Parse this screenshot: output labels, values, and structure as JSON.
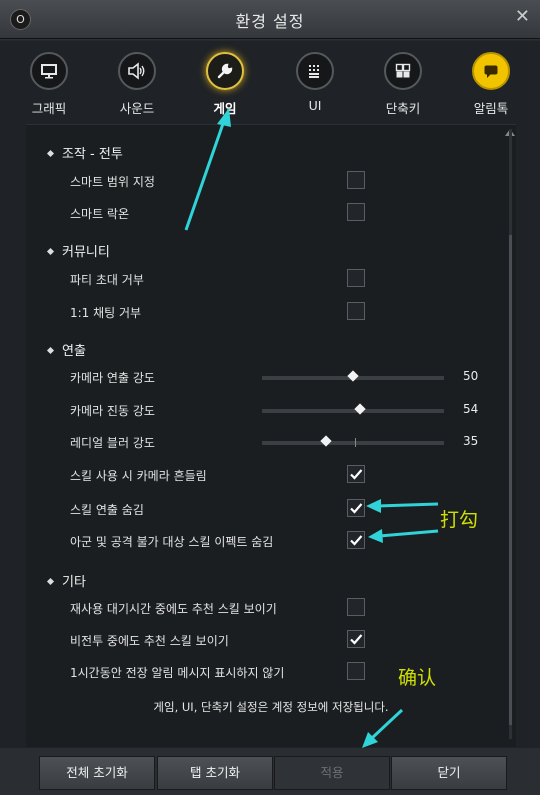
{
  "window": {
    "logo": "O",
    "title": "환경 설정",
    "close_icon": "close-icon"
  },
  "tabs": [
    {
      "label": "그래픽",
      "icon": "monitor-icon",
      "active": false
    },
    {
      "label": "사운드",
      "icon": "speaker-icon",
      "active": false
    },
    {
      "label": "게임",
      "icon": "wrench-icon",
      "active": true
    },
    {
      "label": "UI",
      "icon": "ui-grid-icon",
      "active": false
    },
    {
      "label": "단축키",
      "icon": "shortcut-icon",
      "active": false
    },
    {
      "label": "알림톡",
      "icon": "chat-icon",
      "active": false
    }
  ],
  "sections": {
    "combat": {
      "title": "조작 - 전투",
      "smart_range": "스마트 범위 지정",
      "smart_lockon": "스마트 락온"
    },
    "community": {
      "title": "커뮤니티",
      "party_invite": "파티 초대 거부",
      "whisper": "1:1 채팅 거부"
    },
    "effects": {
      "title": "연출",
      "camera_direction": "카메라 연출 강도",
      "camera_direction_value": "50",
      "camera_shake": "카메라 진동 강도",
      "camera_shake_value": "54",
      "radial_blur": "레디얼 블러 강도",
      "radial_blur_value": "35",
      "skill_shake": "스킬 사용 시 카메라 흔들림",
      "hide_skill": "스킬 연출 숨김",
      "hide_ally_effects": "아군 및 공격 불가 대상 스킬 이펙트 숨김"
    },
    "etc": {
      "title": "기타",
      "cooldown_recommend": "재사용 대기시간 중에도 추천 스킬 보이기",
      "noncombat_recommend": "비전투 중에도 추천 스킬 보이기",
      "battlefield_alert": "1시간동안 전장 알림 메시지 표시하지 않기"
    }
  },
  "checkboxes": {
    "smart_range": false,
    "smart_lockon": false,
    "party_invite": false,
    "whisper": false,
    "skill_shake": true,
    "hide_skill": true,
    "hide_ally_effects": true,
    "cooldown_recommend": false,
    "noncombat_recommend": true,
    "battlefield_alert": false
  },
  "sliders": {
    "camera_direction": 0.5,
    "camera_shake": 0.54,
    "radial_blur": 0.35
  },
  "footer_note": "게임, UI, 단축키 설정은 계정 정보에 저장됩니다.",
  "buttons": {
    "reset_all": "전체 초기화",
    "reset_tab": "탭 초기화",
    "apply": "적용",
    "close": "닫기"
  },
  "annotations": {
    "check_note": "打勾",
    "confirm_note": "确认"
  },
  "colors": {
    "accent": "#e0c040",
    "annotation": "#cfe000",
    "arrow": "#2fd3d8"
  }
}
